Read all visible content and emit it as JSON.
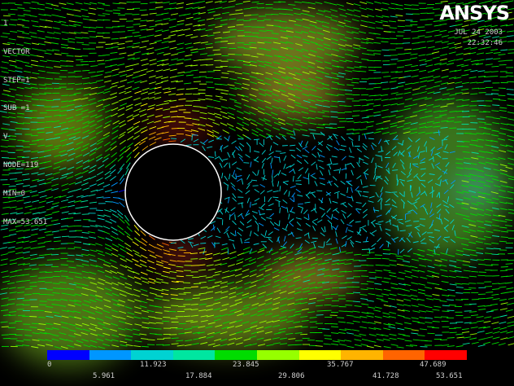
{
  "plot": {
    "info_lines": [
      "1",
      "VECTOR",
      "STEP=1",
      "SUB =1",
      "V",
      "NODE=119",
      "MIN=0",
      "MAX=53.651"
    ],
    "logo": {
      "left": "AN",
      "mid": "S",
      "right": "YS"
    },
    "date": "JUL 24 2003",
    "time": "22:32:46"
  },
  "legend": {
    "colors": [
      "#0000ff",
      "#0096ff",
      "#00d2d2",
      "#00e6a0",
      "#00dc00",
      "#96ff00",
      "#ffff00",
      "#ffb400",
      "#ff6400",
      "#ff0000"
    ],
    "labels_top": [
      "0",
      "11.923",
      "23.845",
      "35.767",
      "47.689"
    ],
    "labels_bottom": [
      "5.961",
      "17.884",
      "29.806",
      "41.728",
      "53.651"
    ]
  },
  "field": {
    "cylinder_color": "#000000",
    "cylinder_outline": "#ffffff",
    "blobs": [
      {
        "color": "#c8ff20"
      },
      {
        "color": "#aaff30"
      },
      {
        "color": "#e8ff40"
      },
      {
        "color": "#ffee40"
      },
      {
        "color": "#ff3020"
      },
      {
        "color": "#ff4030"
      },
      {
        "color": "#80ff40"
      },
      {
        "color": "#40d0ff"
      },
      {
        "color": "#ffee40"
      },
      {
        "color": "#c8ff30"
      }
    ]
  }
}
